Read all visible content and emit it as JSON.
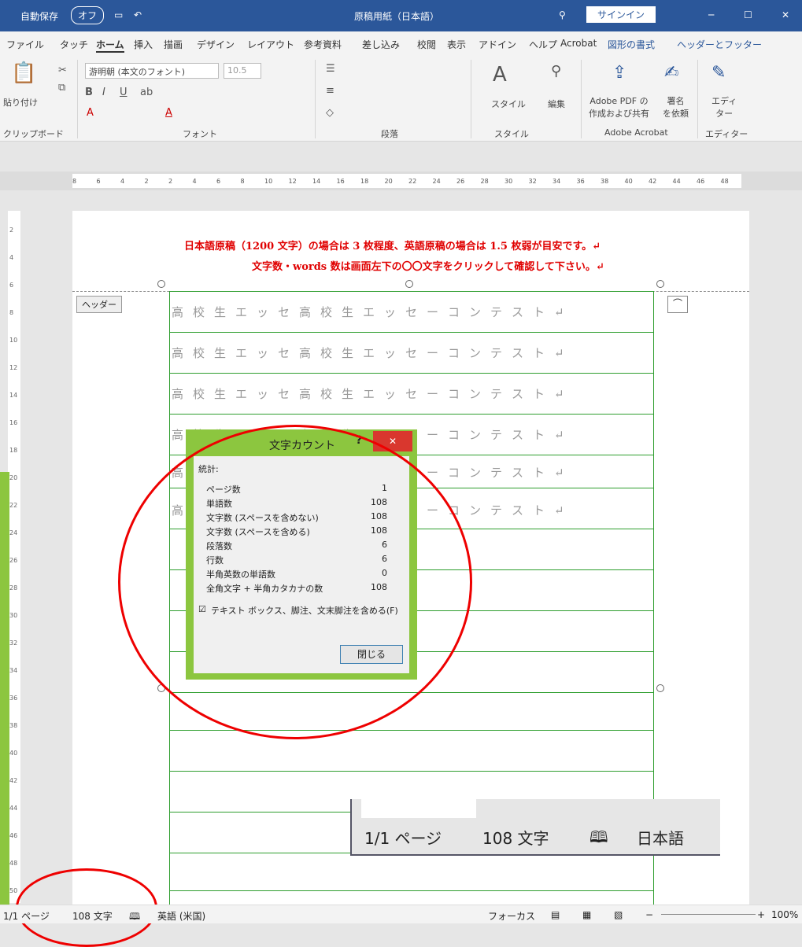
{
  "titlebar": {
    "autosave": "自動保存",
    "autosave_state": "オフ",
    "doc_title": "原稿用紙（日本語）",
    "signin": "サインイン"
  },
  "tabs": [
    "ファイル",
    "タッチ",
    "ホーム",
    "挿入",
    "描画",
    "デザイン",
    "レイアウト",
    "参考資料",
    "差し込み",
    "校閲",
    "表示",
    "アドイン",
    "ヘルプ",
    "Acrobat",
    "図形の書式",
    "ヘッダーとフッター"
  ],
  "ribbon": {
    "paste": "貼り付け",
    "font_name": "游明朝 (本文のフォント)",
    "font_size": "10.5",
    "styles": "スタイル",
    "edit": "編集",
    "adobe_pdf": "Adobe PDF の\n作成および共有",
    "sign": "署名\nを依頼",
    "editor": "エディ\nター",
    "groups": [
      "クリップボード",
      "フォント",
      "段落",
      "スタイル",
      "Adobe Acrobat",
      "エディター"
    ]
  },
  "ruler": [
    "8",
    "6",
    "4",
    "2",
    "2",
    "4",
    "6",
    "8",
    "10",
    "12",
    "14",
    "16",
    "18",
    "20",
    "22",
    "24",
    "26",
    "28",
    "30",
    "32",
    "34",
    "36",
    "38",
    "40",
    "42",
    "44",
    "46",
    "48"
  ],
  "vruler": [
    "2",
    "4",
    "6",
    "8",
    "10",
    "12",
    "14",
    "16",
    "18",
    "20",
    "22",
    "24",
    "26",
    "28",
    "30",
    "32",
    "34",
    "36",
    "38",
    "40",
    "42",
    "44",
    "46",
    "48",
    "50"
  ],
  "page": {
    "line1": "日本語原稿（1200 文字）の場合は 3 枚程度、英語原稿の場合は 1.5 枚弱が目安です。↵",
    "line2": "文字数・words 数は画面左下の〇〇文字をクリックして確認して下さい。↵",
    "header_tag": "ヘッダー",
    "grid_text": "高校生エッセ高校生エッセーコンテスト↵"
  },
  "dialog": {
    "title": "文字カウント",
    "section": "統計:",
    "rows": [
      {
        "label": "ページ数",
        "value": "1"
      },
      {
        "label": "単語数",
        "value": "108"
      },
      {
        "label": "文字数 (スペースを含めない)",
        "value": "108"
      },
      {
        "label": "文字数 (スペースを含める)",
        "value": "108"
      },
      {
        "label": "段落数",
        "value": "6"
      },
      {
        "label": "行数",
        "value": "6"
      },
      {
        "label": "半角英数の単語数",
        "value": "0"
      },
      {
        "label": "全角文字 + 半角カタカナの数",
        "value": "108"
      }
    ],
    "checkbox": "テキスト ボックス、脚注、文末脚注を含める(F)",
    "close": "閉じる"
  },
  "zoom_inset": {
    "pages": "1/1 ページ",
    "chars": "108 文字",
    "lang": "日本語"
  },
  "status": {
    "pages": "1/1 ページ",
    "chars": "108 文字",
    "lang": "英語 (米国)",
    "focus": "フォーカス",
    "zoom": "100%"
  }
}
